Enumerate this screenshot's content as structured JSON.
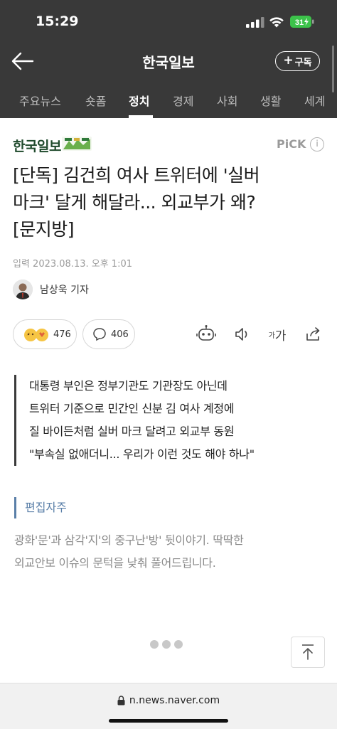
{
  "status_bar": {
    "time": "15:29",
    "battery": "31"
  },
  "header": {
    "title": "한국일보",
    "subscribe_label": "구독"
  },
  "tabs": [
    {
      "label": "주요뉴스"
    },
    {
      "label": "숏폼"
    },
    {
      "label": "정치",
      "active": true
    },
    {
      "label": "경제"
    },
    {
      "label": "사회"
    },
    {
      "label": "생활"
    },
    {
      "label": "세계"
    }
  ],
  "article": {
    "press_name": "한국일보",
    "pick_label": "PiCK",
    "headline_lines": [
      "[단독] 김건희 여사 트위터에 '실버",
      "마크' 달게 해달라... 외교부가 왜?",
      "[문지방]"
    ],
    "date": "입력 2023.08.13. 오후 1:01",
    "reporter": "남상욱 기자",
    "reactions": {
      "like_count": "476",
      "comment_count": "406"
    },
    "font_size_label_small": "가",
    "font_size_label_large": "가",
    "summary_lines": [
      "대통령 부인은 정부기관도 기관장도 아닌데",
      "트위터 기준으로 민간인 신분 김 여사 계정에",
      "질 바이든처럼 실버 마크 달려고 외교부 동원",
      "\"부속실 없애더니... 우리가 이런 것도 해야 하나\""
    ],
    "editor_note_title": "편집자주",
    "editor_note_lines": [
      "광화'문'과 삼각'지'의 중구난'방' 뒷이야기. 딱딱한",
      "외교안보 이슈의 문턱을 낮춰 풀어드립니다."
    ]
  },
  "footer": {
    "url": "n.news.naver.com"
  },
  "colors": {
    "header_bg": "#393939",
    "accent_green": "#1f4a2c",
    "note_blue": "#5a7fa8"
  }
}
